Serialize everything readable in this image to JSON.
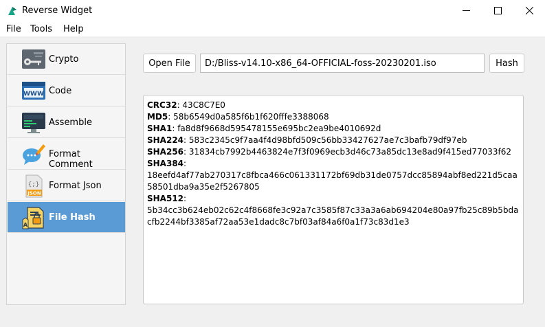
{
  "window": {
    "title": "Reverse Widget"
  },
  "menu": [
    "File",
    "Tools",
    "Help"
  ],
  "sidebar": {
    "items": [
      {
        "label": "Crypto",
        "icon": "crypto-key-icon",
        "active": false
      },
      {
        "label": "Code",
        "icon": "www-code-icon",
        "active": false
      },
      {
        "label": "Assemble",
        "icon": "binary-monitor-icon",
        "active": false
      },
      {
        "label": "Format Comment",
        "icon": "speech-bubble-pencil-icon",
        "active": false
      },
      {
        "label": "Format Json",
        "icon": "json-file-icon",
        "active": false
      },
      {
        "label": "File Hash",
        "icon": "file-lock-icon",
        "active": true
      }
    ]
  },
  "toolbar": {
    "open_file_label": "Open File",
    "path_value": "D:/Bliss-v14.10-x86_64-OFFICIAL-foss-20230201.iso",
    "hash_label": "Hash"
  },
  "output": {
    "rows": [
      {
        "key": "CRC32",
        "value": "43C8C7E0"
      },
      {
        "key": "MD5",
        "value": "58b6549d0a585f6b1f620fffe3388068"
      },
      {
        "key": "SHA1",
        "value": "fa8d8f9668d595478155e695bc2ea9be4010692d"
      },
      {
        "key": "SHA224",
        "value": "583c2345c9f7aa4f4d98bfd509c56bb33427627ae7c3bafb79df97eb"
      },
      {
        "key": "SHA256",
        "value": "31834cb7992b4463824e7f3f0969ecb3d46c73a85dc13e8ad9f415ed77033f62"
      },
      {
        "key": "SHA384",
        "value": "18eefd4af77ab270317c8fbca466c061331172bf69db31de0757dcc85894abf8ed221d5caa58501dba9a35e2f5267805"
      },
      {
        "key": "SHA512",
        "value": "5b34cc3b624eb02c62c4f8668fe3c92a7c3585f87c33a3a6ab694204e80a97fb25c89b5bdacfb2244bf3385af72aa53e1dadc8c7bf03af84a6f0a1f73c83d1e3"
      }
    ]
  },
  "colors": {
    "accent": "#5b9bd5",
    "titlebar_icon": "#17a589"
  }
}
